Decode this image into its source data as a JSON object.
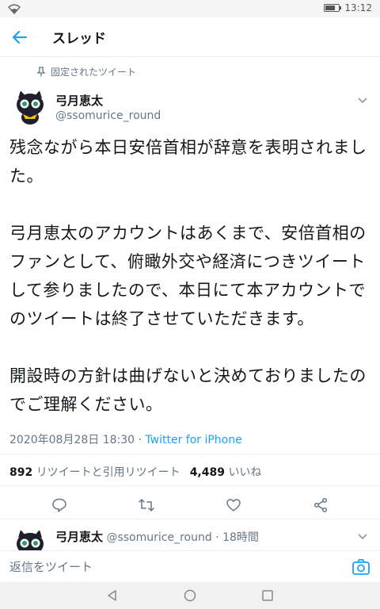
{
  "status_bar": {
    "time": "13:12",
    "battery_level": 0.75
  },
  "app_bar": {
    "title": "スレッド"
  },
  "pinned_label": "固定されたツイート",
  "tweet": {
    "author_name": "弓月恵太",
    "author_handle": "@ssomurice_round",
    "paragraphs": [
      "残念ながら本日安倍首相が辞意を表明されました。",
      "弓月恵太のアカウントはあくまで、安倍首相のファンとして、俯瞰外交や経済につきツイートして参りましたので、本日にて本アカウントでのツイートは終了させていただきます。",
      "開設時の方針は曲げないと決めておりましたのでご理解ください。"
    ],
    "timestamp": "2020年08月28日 18:30 · ",
    "source": "Twitter for iPhone",
    "retweets_count": "892",
    "retweets_label": "リツイートと引用リツイート",
    "likes_count": "4,489",
    "likes_label": "いいね"
  },
  "reply_preview": {
    "name": "弓月恵太",
    "meta": "@ssomurice_round · 18時間"
  },
  "reply_bar": {
    "placeholder": "返信をツイート"
  },
  "colors": {
    "accent": "#1da1f2",
    "secondary_text": "#657786",
    "divider": "#e6ecf0"
  }
}
